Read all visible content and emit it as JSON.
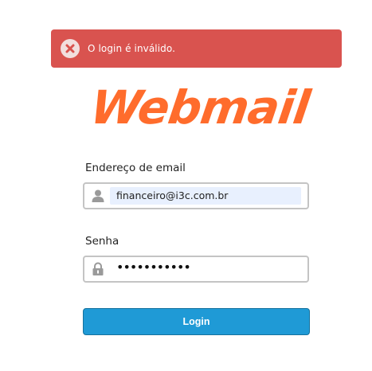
{
  "error": {
    "message": "O login é inválido.",
    "icon": "error-x-icon",
    "color": "#d9534f"
  },
  "logo": {
    "text": "Webmail",
    "color": "#ff6c2c"
  },
  "form": {
    "email_label": "Endereço de email",
    "email_value": "financeiro@i3c.com.br",
    "email_icon": "user-icon",
    "password_label": "Senha",
    "password_value": "•••••••••••",
    "password_icon": "lock-icon",
    "login_label": "Login",
    "accent": "#1f9ad6"
  }
}
